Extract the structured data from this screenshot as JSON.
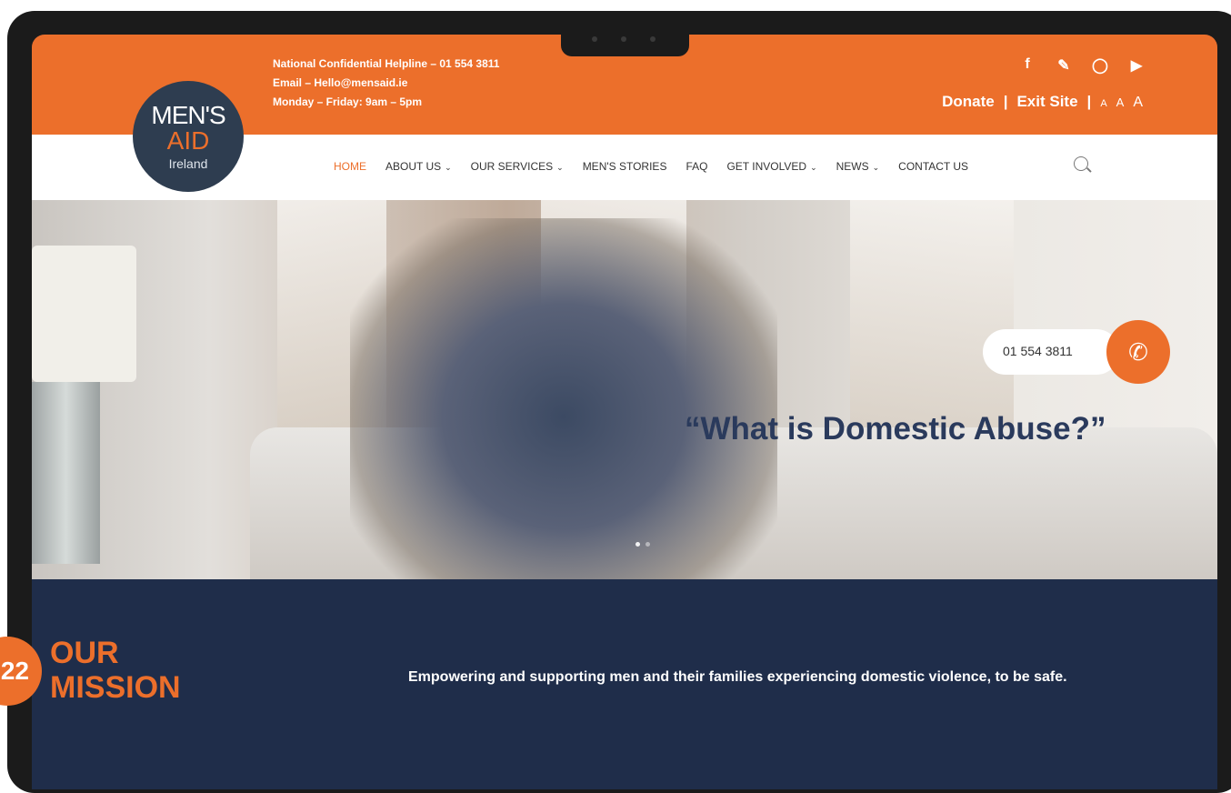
{
  "header": {
    "helpline": "National Confidential Helpline – 01 554 3811",
    "email": "Email – Hello@mensaid.ie",
    "hours": "Monday – Friday: 9am – 5pm",
    "social_icons": [
      "facebook-icon",
      "twitter-icon",
      "instagram-icon",
      "youtube-icon"
    ],
    "donate": "Donate",
    "separator": "|",
    "exit_site": "Exit Site",
    "font_small": "A",
    "font_medium": "A",
    "font_large": "A"
  },
  "logo": {
    "line1": "MEN'S",
    "line2": "AID",
    "line3": "Ireland"
  },
  "nav": {
    "items": [
      {
        "label": "HOME",
        "dropdown": false,
        "active": true
      },
      {
        "label": "ABOUT US",
        "dropdown": true
      },
      {
        "label": "OUR SERVICES",
        "dropdown": true
      },
      {
        "label": "MEN'S STORIES",
        "dropdown": false
      },
      {
        "label": "FAQ",
        "dropdown": false
      },
      {
        "label": "GET INVOLVED",
        "dropdown": true
      },
      {
        "label": "NEWS",
        "dropdown": true
      },
      {
        "label": "CONTACT US",
        "dropdown": false
      }
    ]
  },
  "hero": {
    "phone": "01 554 3811",
    "headline": "“What is Domestic Abuse?”"
  },
  "mission": {
    "title_line1": "OUR",
    "title_line2": "MISSION",
    "text": "Empowering and supporting men and their families experiencing domestic violence, to be safe."
  },
  "badge": {
    "number": "22"
  },
  "colors": {
    "accent": "#ec6f2b",
    "navy": "#1f2d4a",
    "logo_bg": "#2e3d50"
  }
}
